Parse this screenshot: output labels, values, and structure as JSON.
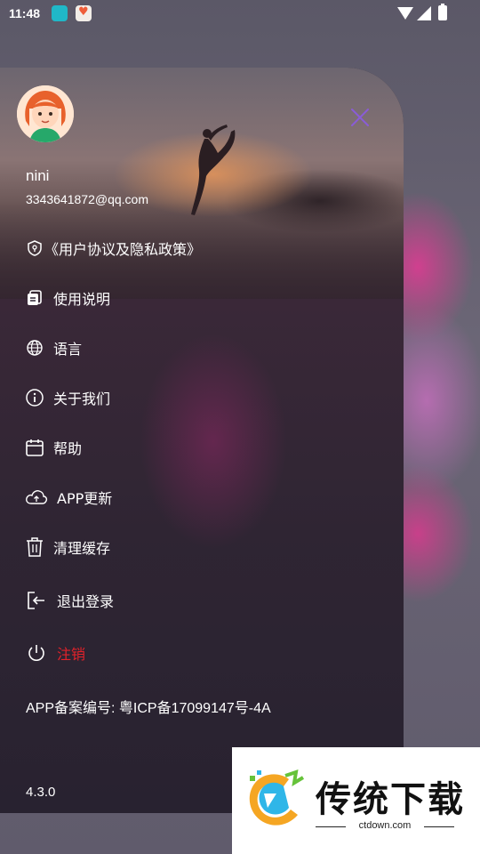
{
  "status_bar": {
    "time": "11:48"
  },
  "profile": {
    "name": "nini",
    "email": "3343641872@qq.com"
  },
  "menu": [
    {
      "label": "《用户协议及隐私政策》",
      "icon": "shield-icon"
    },
    {
      "label": "使用说明",
      "icon": "document-icon"
    },
    {
      "label": "语言",
      "icon": "globe-icon"
    },
    {
      "label": "关于我们",
      "icon": "info-icon"
    },
    {
      "label": "帮助",
      "icon": "calendar-icon"
    },
    {
      "label": "APP更新",
      "icon": "cloud-icon"
    },
    {
      "label": "清理缓存",
      "icon": "trash-icon"
    },
    {
      "label": "退出登录",
      "icon": "logout-icon"
    },
    {
      "label": "注销",
      "icon": "power-icon",
      "color": "#e2222a"
    }
  ],
  "icp": "APP备案编号: 粤ICP备17099147号-4A",
  "version": "4.3.0",
  "watermark": {
    "brand": "传统下载",
    "site": "ctdown.com"
  },
  "colors": {
    "close": "#8a5cd6",
    "danger": "#e2222a"
  }
}
